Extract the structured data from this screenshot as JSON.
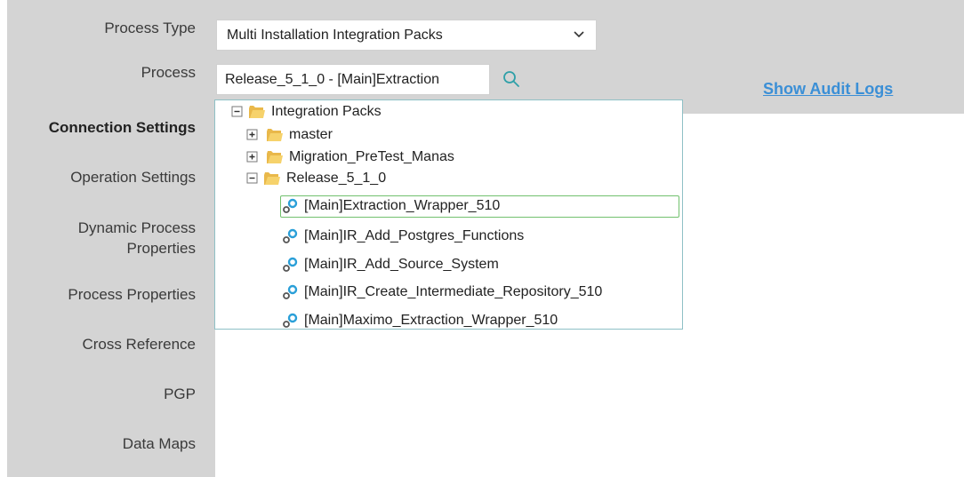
{
  "labels": {
    "process_type": "Process Type",
    "process": "Process",
    "connection_settings": "Connection Settings",
    "operation_settings": "Operation Settings",
    "dynamic_process_properties_1": "Dynamic Process",
    "dynamic_process_properties_2": "Properties",
    "process_properties": "Process Properties",
    "cross_reference": "Cross Reference",
    "pgp": "PGP",
    "data_maps": "Data Maps"
  },
  "process_type_select": {
    "value": "Multi Installation Integration Packs"
  },
  "process_input": {
    "value": "Release_5_1_0 - [Main]Extraction"
  },
  "show_audit_logs": "Show Audit Logs",
  "tree": {
    "root": "Integration Packs",
    "folders": [
      "master",
      "Migration_PreTest_Manas",
      "Release_5_1_0"
    ],
    "processes": [
      "[Main]Extraction_Wrapper_510",
      "[Main]IR_Add_Postgres_Functions",
      "[Main]IR_Add_Source_System",
      "[Main]IR_Create_Intermediate_Repository_510",
      "[Main]Maximo_Extraction_Wrapper_510"
    ],
    "selected_index": 0
  },
  "colors": {
    "panel_gray": "#d4d4d4",
    "link_blue": "#3b8fd6",
    "selection_green": "#72c16e",
    "folder_yellow": "#f2c94c"
  },
  "icons": [
    "chevron-down-icon",
    "search-icon",
    "collapse-icon",
    "expand-icon",
    "folder-icon",
    "process-gear-icon"
  ]
}
